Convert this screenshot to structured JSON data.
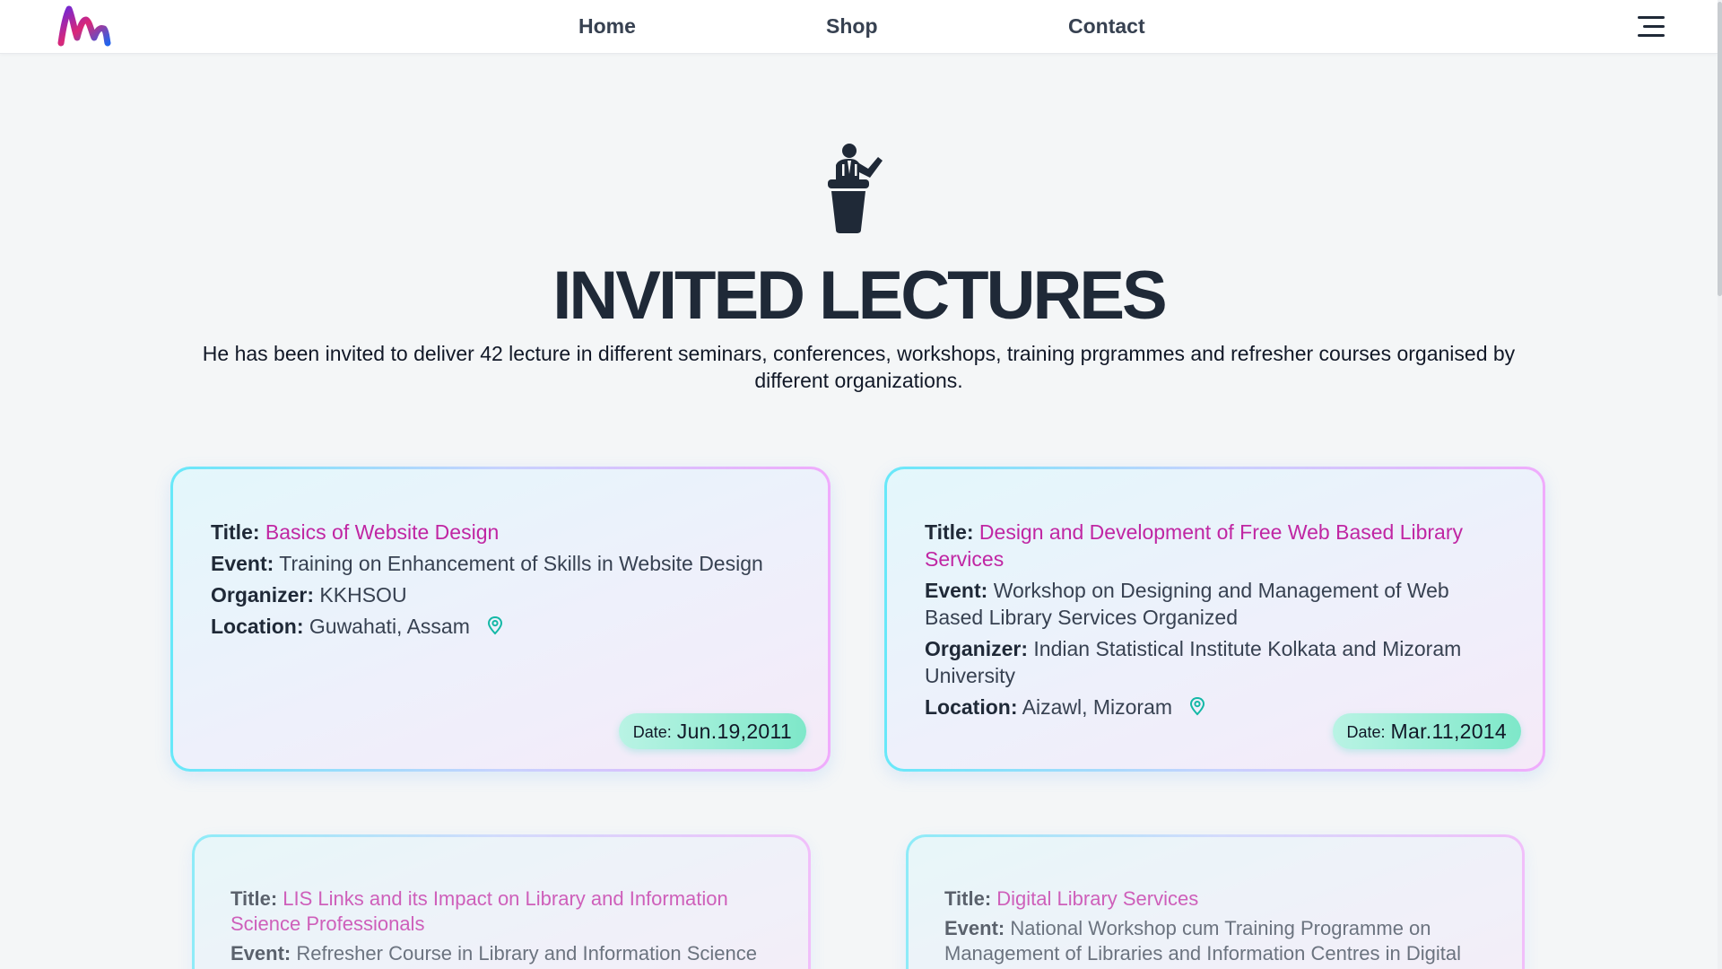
{
  "nav": {
    "links": [
      "Home",
      "Shop",
      "Contact"
    ],
    "logo_icon": "brand-logo-icon",
    "menu_icon": "hamburger-menu-icon"
  },
  "hero": {
    "icon": "lecturer-podium-icon",
    "title": "INVITED LECTURES",
    "intro": "He has been invited to deliver 42 lecture in different seminars, conferences, workshops, training prgrammes and refresher courses organised by different organizations."
  },
  "labels": {
    "title": "Title:",
    "event": "Event:",
    "organizer": "Organizer:",
    "location": "Location:",
    "date": "Date:"
  },
  "lectures": [
    {
      "title": "Basics of Website Design",
      "event": "Training on Enhancement of Skills in Website Design",
      "organizer": "KKHSOU",
      "location": "Guwahati, Assam",
      "date": "Jun.19,2011"
    },
    {
      "title": "Design and Development of Free Web Based Library Services",
      "event": "Workshop on Designing and Management of Web Based Library Services Organized",
      "organizer": "Indian Statistical Institute Kolkata and Mizoram University",
      "location": "Aizawl, Mizoram",
      "date": "Mar.11,2014"
    },
    {
      "title": "LIS Links and its Impact on Library and Information Science Professionals",
      "event": "Refresher Course in Library and Information Science"
    },
    {
      "title": "Digital Library Services",
      "event": "National Workshop cum Training Programme on Management of Libraries and Information Centres in Digital"
    }
  ],
  "colors": {
    "title_accent": "#c026a3",
    "card_border_start": "#67e8f9",
    "card_border_end": "#f0abfc",
    "date_badge": "#7ee8c9",
    "pin_icon": "#14b8a6",
    "heading": "#1f2937"
  }
}
